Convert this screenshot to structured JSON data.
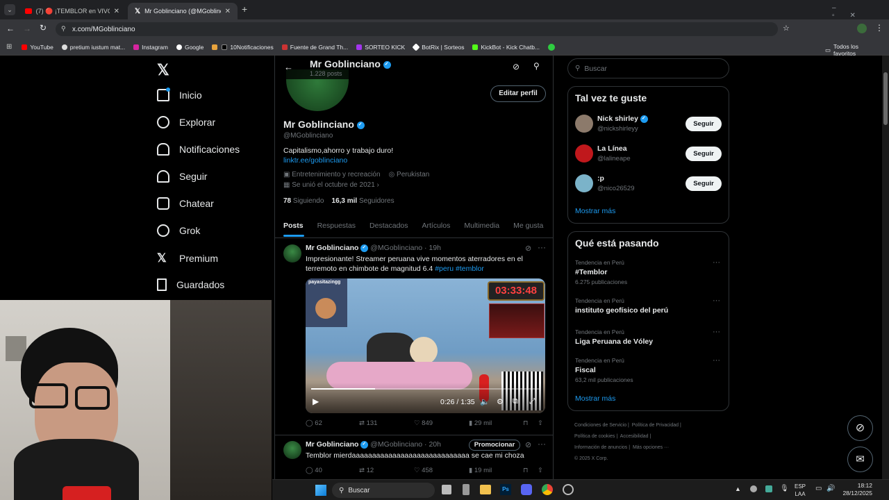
{
  "browser": {
    "tabs": [
      {
        "title": "(7) 🔴 ¡TEMBLOR en VIVO! 🇵🇪 ..."
      },
      {
        "title": "Mr Goblinciano (@MGoblinciano"
      }
    ],
    "url": "x.com/MGoblinciano",
    "bookmarks": [
      "YouTube",
      "pretium iustum mat...",
      "Instagram",
      "Google",
      "10Notificaciones",
      "Fuente de Grand Th...",
      "SORTEO KICK",
      "BotRix | Sorteos",
      "KickBot - Kick Chatb..."
    ],
    "all_bookmarks": "Todos los favoritos"
  },
  "nav": {
    "items": [
      "Inicio",
      "Explorar",
      "Notificaciones",
      "Seguir",
      "Chatear",
      "Grok",
      "Premium",
      "Guardados"
    ]
  },
  "profile": {
    "header_name": "Mr Goblinciano",
    "header_posts": "1.228 posts",
    "edit_button": "Editar perfil",
    "name": "Mr Goblinciano",
    "handle": "@MGoblinciano",
    "bio": "Capitalismo,ahorro y trabajo duro!",
    "link": "linktr.ee/goblinciano",
    "category": "Entretenimiento y recreación",
    "location": "Perukistan",
    "joined": "Se unió el octubre de 2021",
    "following_count": "78",
    "following_label": "Siguiendo",
    "followers_count": "16,3 mil",
    "followers_label": "Seguidores"
  },
  "profile_tabs": [
    "Posts",
    "Respuestas",
    "Destacados",
    "Artículos",
    "Multimedia",
    "Me gusta"
  ],
  "posts": [
    {
      "name": "Mr Goblinciano",
      "handle": "@MGoblinciano",
      "time": "· 19h",
      "text_line1": "Impresionante! Streamer peruana vive momentos aterradores en el",
      "text_line2": "terremoto en chimbote de magnitud 6.4",
      "hashtags": "#peru #temblor",
      "video_time": "0:26 / 1:35",
      "video_overlay_timer": "03:33:48",
      "video_overlay_name": "payasitazingg",
      "replies": "62",
      "reposts": "131",
      "likes": "849",
      "views": "29 mil"
    },
    {
      "name": "Mr Goblinciano",
      "handle": "@MGoblinciano",
      "time": "· 20h",
      "promote": "Promocionar",
      "text": "Temblor mierdaaaaaaaaaaaaaaaaaaaaaaaaaaaaa se cae mi choza",
      "replies": "40",
      "reposts": "12",
      "likes": "458",
      "views": "19 mil"
    }
  ],
  "right": {
    "search_placeholder": "Buscar",
    "suggest_title": "Tal vez te guste",
    "suggestions": [
      {
        "name": "Nick shirley",
        "handle": "@nickshirleyy",
        "button": "Seguir"
      },
      {
        "name": "La Línea",
        "handle": "@lalineape",
        "button": "Seguir"
      },
      {
        "name": ":p",
        "handle": "@nico26529",
        "button": "Seguir"
      }
    ],
    "show_more": "Mostrar más",
    "trends_title": "Qué está pasando",
    "trends": [
      {
        "context": "Tendencia en Perú",
        "topic": "#Temblor",
        "count": "6.275 publicaciones"
      },
      {
        "context": "Tendencia en Perú",
        "topic": "instituto geofísico del perú",
        "count": ""
      },
      {
        "context": "Tendencia en Perú",
        "topic": "Liga Peruana de Vóley",
        "count": ""
      },
      {
        "context": "Tendencia en Perú",
        "topic": "Fiscal",
        "count": "63,2 mil publicaciones"
      }
    ],
    "trends_more": "Mostrar más",
    "footer": [
      "Condiciones de Servicio",
      "Política de Privacidad",
      "Política de cookies",
      "Accesibilidad",
      "Información de anuncios",
      "Más opciones ···",
      "© 2025 X Corp."
    ]
  },
  "taskbar": {
    "search": "Buscar",
    "lang1": "ESP",
    "lang2": "LAA",
    "time": "18:12",
    "date": "28/12/2025"
  },
  "colors": {
    "accent": "#1d9bf0",
    "bg": "#000000",
    "muted": "#71767b",
    "border": "#2f3336"
  }
}
